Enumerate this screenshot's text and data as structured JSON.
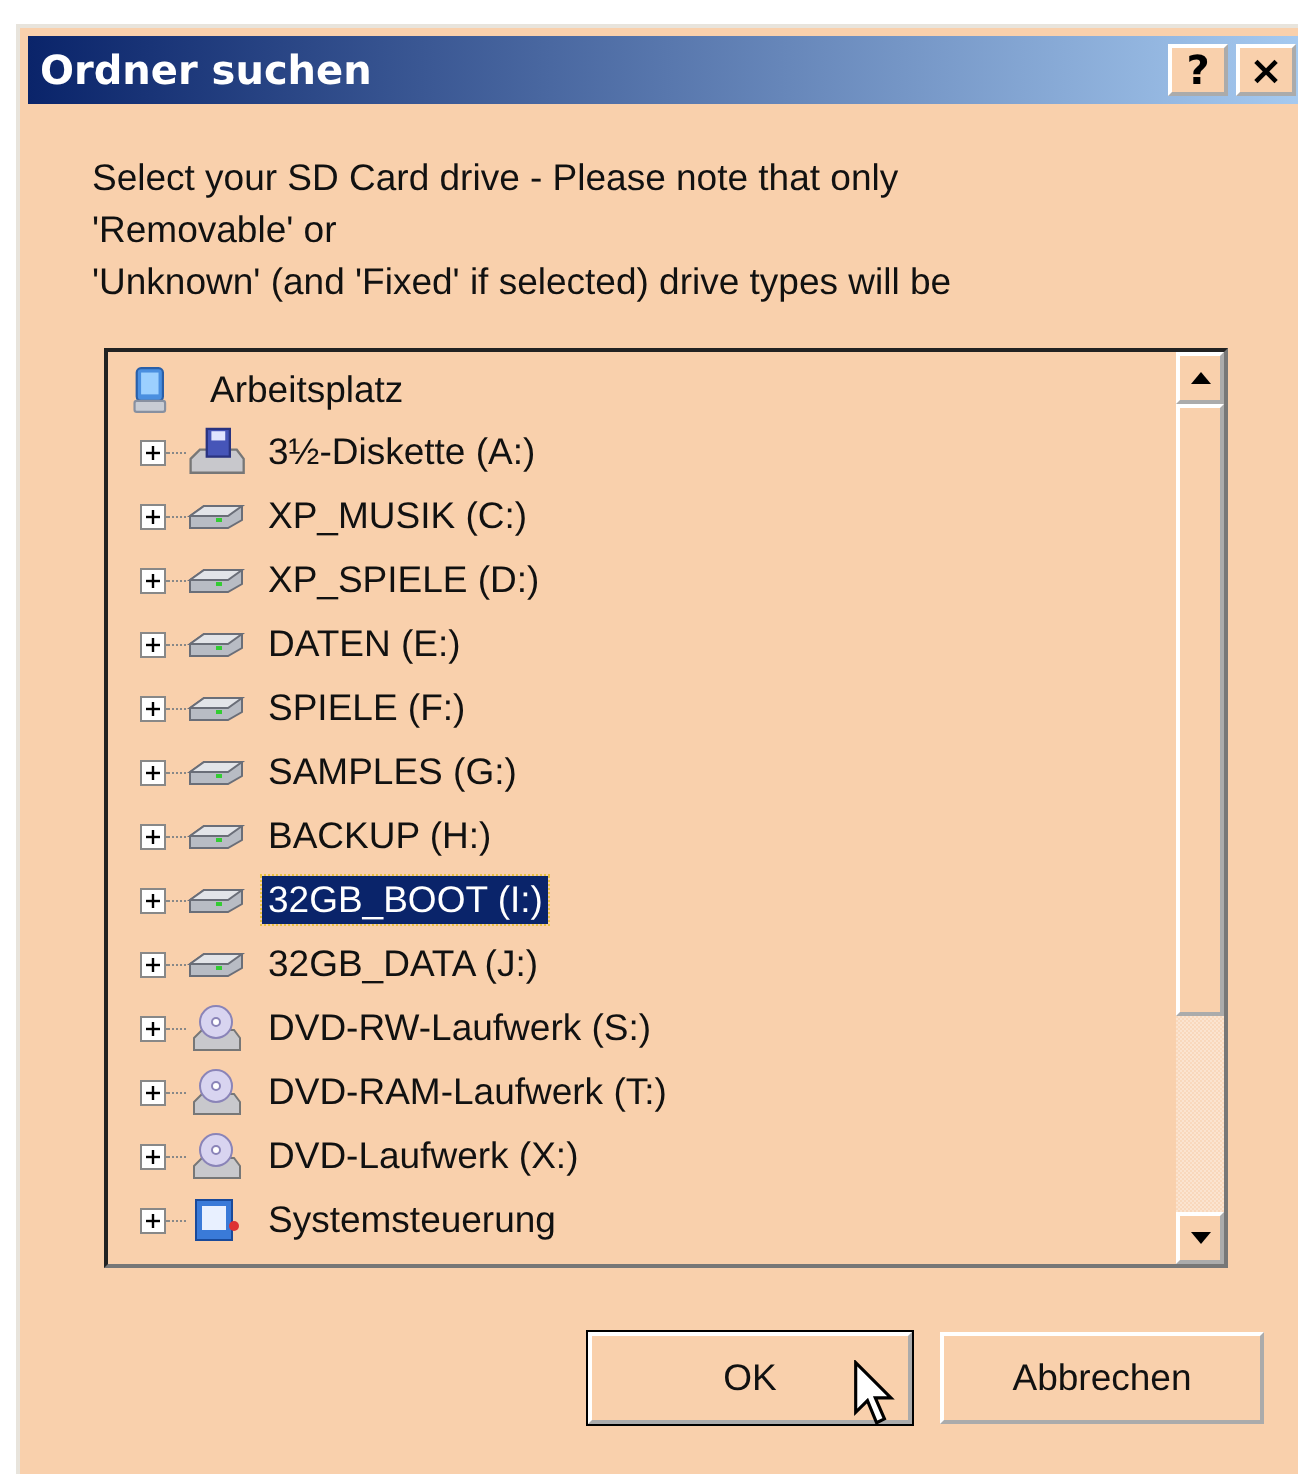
{
  "window": {
    "title": "Ordner suchen",
    "title_buttons": [
      "?",
      "×"
    ]
  },
  "instructions": [
    "Select your SD Card drive - Please note that only",
    "'Removable' or",
    "'Unknown' (and 'Fixed' if selected) drive types will be"
  ],
  "tree": {
    "root": {
      "label": "Arbeitsplatz",
      "kind": "computer",
      "children": [
        {
          "label": "3½-Diskette (A:)",
          "kind": "floppy",
          "expanded": false,
          "selected": false
        },
        {
          "label": "XP_MUSIK (C:)",
          "kind": "disk",
          "expanded": false,
          "selected": false
        },
        {
          "label": "XP_SPIELE (D:)",
          "kind": "disk",
          "expanded": false,
          "selected": false
        },
        {
          "label": "DATEN (E:)",
          "kind": "disk",
          "expanded": false,
          "selected": false
        },
        {
          "label": "SPIELE (F:)",
          "kind": "disk",
          "expanded": false,
          "selected": false
        },
        {
          "label": "SAMPLES (G:)",
          "kind": "disk",
          "expanded": false,
          "selected": false
        },
        {
          "label": "BACKUP (H:)",
          "kind": "disk",
          "expanded": false,
          "selected": false
        },
        {
          "label": "32GB_BOOT (I:)",
          "kind": "disk",
          "expanded": false,
          "selected": true
        },
        {
          "label": "32GB_DATA (J:)",
          "kind": "disk",
          "expanded": false,
          "selected": false
        },
        {
          "label": "DVD-RW-Laufwerk (S:)",
          "kind": "dvd",
          "expanded": false,
          "selected": false
        },
        {
          "label": "DVD-RAM-Laufwerk (T:)",
          "kind": "dvd",
          "expanded": false,
          "selected": false
        },
        {
          "label": "DVD-Laufwerk (X:)",
          "kind": "dvd",
          "expanded": false,
          "selected": false
        },
        {
          "label": "Systemsteuerung",
          "kind": "control_panel",
          "expanded": false,
          "selected": false
        }
      ]
    }
  },
  "buttons": [
    {
      "label": "OK",
      "default": true
    },
    {
      "label": "Abbrechen",
      "default": false
    }
  ]
}
